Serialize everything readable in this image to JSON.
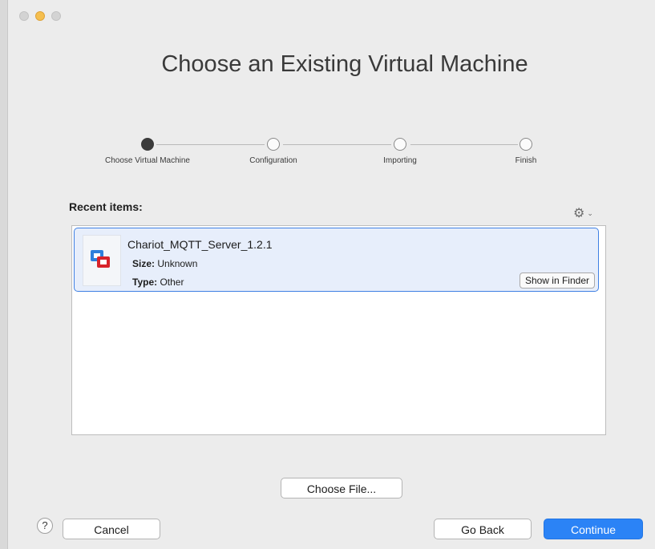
{
  "window": {
    "title": "Choose an Existing Virtual Machine"
  },
  "steps": [
    {
      "label": "Choose Virtual Machine",
      "active": true
    },
    {
      "label": "Configuration",
      "active": false
    },
    {
      "label": "Importing",
      "active": false
    },
    {
      "label": "Finish",
      "active": false
    }
  ],
  "recent": {
    "label": "Recent items:",
    "settings_icon": "gear-icon",
    "items": [
      {
        "name": "Chariot_MQTT_Server_1.2.1",
        "size_label": "Size:",
        "size_value": "Unknown",
        "type_label": "Type:",
        "type_value": "Other",
        "show_in_finder": "Show in Finder",
        "selected": true
      }
    ]
  },
  "buttons": {
    "choose_file": "Choose File...",
    "help": "?",
    "cancel": "Cancel",
    "go_back": "Go Back",
    "continue": "Continue"
  },
  "colors": {
    "accent": "#2b83f6",
    "selection_bg": "#e7eefb",
    "selection_border": "#3f80e3"
  }
}
